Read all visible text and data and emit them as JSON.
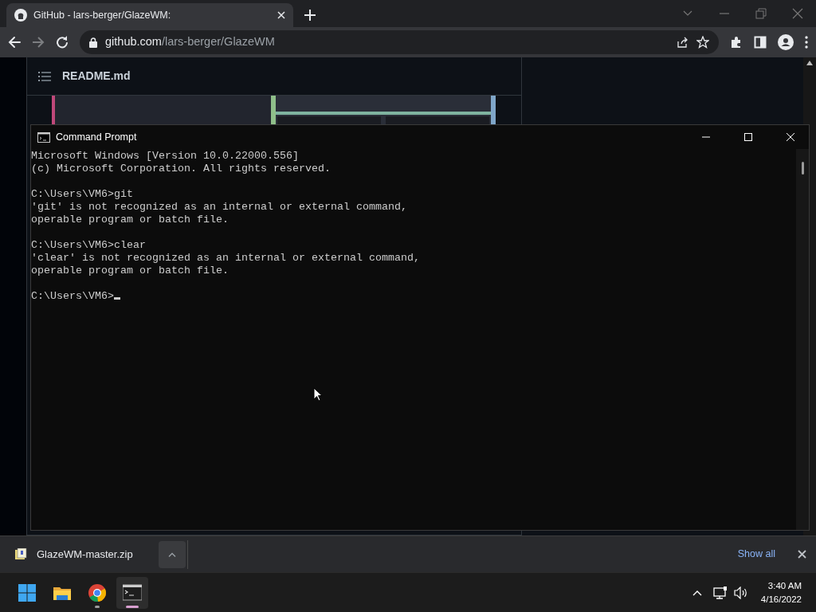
{
  "browser": {
    "tabs": [
      {
        "title": "GitHub - lars-berger/GlazeWM:",
        "selected": true
      }
    ],
    "address": {
      "domain": "github.com",
      "path": "/lars-berger/GlazeWM"
    }
  },
  "readme": {
    "title": "README.md"
  },
  "console": {
    "title": "Command Prompt",
    "cursor": true,
    "blocks": [
      [
        "Microsoft Windows [Version 10.0.22000.556]",
        "(c) Microsoft Corporation. All rights reserved."
      ],
      [
        "C:\\Users\\VM6>git",
        "'git' is not recognized as an internal or external command,",
        "operable program or batch file."
      ],
      [
        "C:\\Users\\VM6>clear",
        "'clear' is not recognized as an internal or external command,",
        "operable program or batch file."
      ],
      [
        "C:\\Users\\VM6>"
      ]
    ]
  },
  "downloads": {
    "items": [
      {
        "name": "GlazeWM-master.zip"
      }
    ],
    "show_all": "Show all"
  },
  "taskbar": {
    "apps": [
      {
        "kind": "start",
        "running": false,
        "active": false
      },
      {
        "kind": "explorer",
        "running": false,
        "active": false
      },
      {
        "kind": "chrome",
        "running": true,
        "active": false
      },
      {
        "kind": "terminal",
        "running": true,
        "active": true
      }
    ],
    "time": "3:40 AM",
    "date": "4/16/2022"
  }
}
